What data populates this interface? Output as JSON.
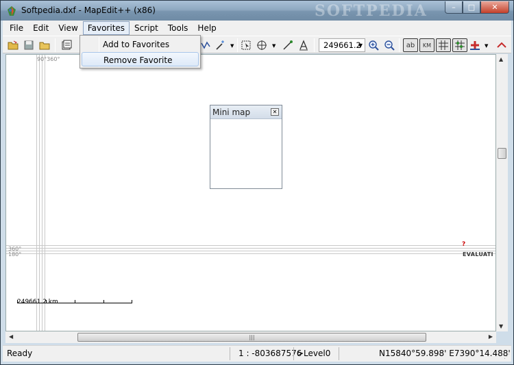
{
  "window": {
    "title": "Softpedia.dxf - MapEdit++ (x86)",
    "watermark": "SOFTPEDIA",
    "buttons": {
      "minimize": "–",
      "maximize": "□",
      "close": "✕"
    }
  },
  "menubar": {
    "items": [
      "File",
      "Edit",
      "View",
      "Favorites",
      "Script",
      "Tools",
      "Help"
    ],
    "open_menu": "Favorites"
  },
  "favorites_menu": {
    "items": [
      "Add to Favorites",
      "Remove Favorite"
    ],
    "hovered": "Remove Favorite"
  },
  "toolbar": {
    "zoom_value": "249661.2",
    "toggle_ab": "ab",
    "toggle_km": "KM",
    "icons": [
      "open-icon",
      "save-icon",
      "folder-icon",
      "properties-icon",
      "polyline-icon",
      "magic-wand-icon",
      "select-icon",
      "pan-icon",
      "route-icon",
      "measure-icon",
      "zoom-in-icon",
      "zoom-out-icon",
      "labels-toggle-icon",
      "km-toggle-icon",
      "grid-icon",
      "snap-icon",
      "marker-icon"
    ]
  },
  "canvas": {
    "top_label": "90°360°",
    "left_label_1": "360°",
    "left_label_2": "180°",
    "scalebar_label": "249661.2 km",
    "evaluation_mark": "EVALUATI",
    "question_mark": "?"
  },
  "minimap": {
    "title": "Mini map",
    "close": "✕"
  },
  "statusbar": {
    "state": "Ready",
    "scale": "1 : -803687576",
    "level": ">Level0",
    "coords": "N15840°59.898' E7390°14.488'"
  },
  "colors": {
    "titlebar": "#8fa9c1",
    "menu_highlight": "#dde9f8",
    "gridline": "#c8c8c8"
  }
}
